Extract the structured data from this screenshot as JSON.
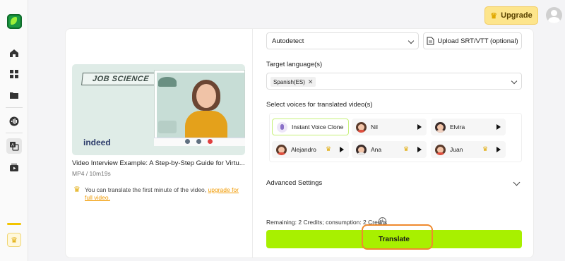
{
  "app": {
    "upgrade_label": "Upgrade"
  },
  "sidebar": {
    "items": [
      {
        "name": "home-icon"
      },
      {
        "name": "dashboard-icon"
      },
      {
        "name": "folder-icon"
      },
      {
        "name": "audio-wave-icon"
      },
      {
        "name": "translate-icon"
      },
      {
        "name": "video-add-icon"
      }
    ]
  },
  "video": {
    "thumbnail_banner": "JOB SCIENCE",
    "thumbnail_brand": "indeed",
    "title": "Video Interview Example: A Step-by-Step Guide for Virtu...",
    "meta": "MP4 / 10m19s",
    "note_text": "You can translate the first minute of the video, ",
    "note_link": "upgrade for full video."
  },
  "form": {
    "source_language": "Autodetect",
    "upload_label": "Upload SRT/VTT (optional)",
    "target_label": "Target language(s)",
    "target_chip": "Spanish(ES)",
    "voices_label": "Select voices for translated video(s)",
    "voices": [
      {
        "label": "Instant Voice Clone",
        "selected": true
      },
      {
        "label": "Nil",
        "premium": false
      },
      {
        "label": "Elvira",
        "premium": false
      },
      {
        "label": "Alejandro",
        "premium": true
      },
      {
        "label": "Ana",
        "premium": true
      },
      {
        "label": "Juan",
        "premium": true
      }
    ],
    "advanced_label": "Advanced Settings",
    "credits_text": "Remaining: 2 Credits; consumption: 2 Credits",
    "translate_label": "Translate"
  },
  "colors": {
    "accent": "#a8f000",
    "upgrade_bg": "#fde58c",
    "highlight": "#ef8a2e"
  }
}
